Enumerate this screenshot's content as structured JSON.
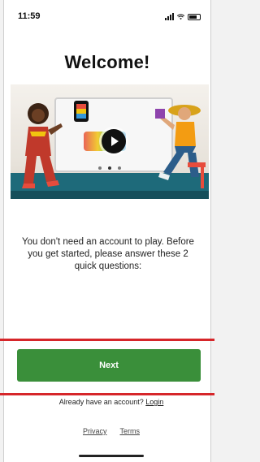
{
  "status_bar": {
    "time": "11:59"
  },
  "screen": {
    "title": "Welcome!",
    "description": "You don't need an account to play. Before you get started, please answer these 2 quick questions:"
  },
  "hero": {
    "video_control": "play-icon"
  },
  "actions": {
    "next_label": "Next",
    "login_prompt": "Already have an account?",
    "login_link": "Login"
  },
  "footer": {
    "privacy": "Privacy",
    "terms": "Terms"
  },
  "colors": {
    "primary_button": "#3a8f3a",
    "highlight": "#d6262a"
  }
}
